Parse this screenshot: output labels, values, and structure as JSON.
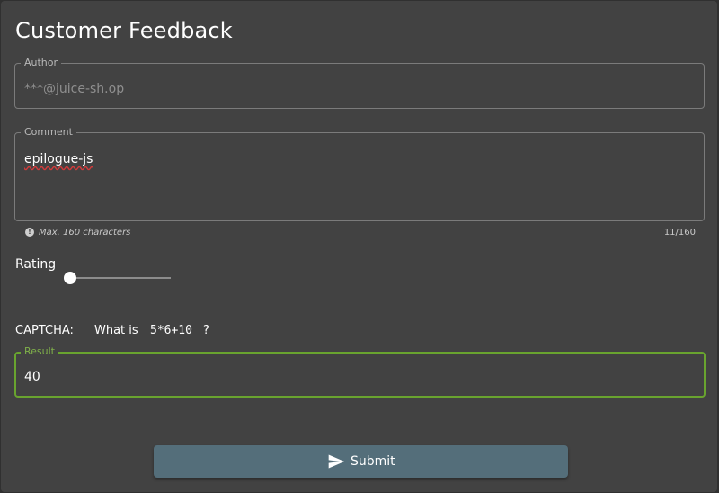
{
  "page": {
    "title": "Customer Feedback"
  },
  "author": {
    "label": "Author",
    "value": "***@juice-sh.op"
  },
  "comment": {
    "label": "Comment",
    "value": "epilogue-js",
    "hint": "Max. 160 characters",
    "counter": "11/160"
  },
  "rating": {
    "label": "Rating",
    "value_fraction": 0.0
  },
  "captcha": {
    "label": "CAPTCHA:",
    "question_prefix": "What is",
    "expression": "5*6+10",
    "question_suffix": "?",
    "result_label": "Result",
    "result_value": "40"
  },
  "submit": {
    "label": "Submit",
    "icon": "send-icon"
  },
  "colors": {
    "card_bg": "#424242",
    "button_bg": "#546e7a",
    "focus_border": "#69a42f"
  }
}
